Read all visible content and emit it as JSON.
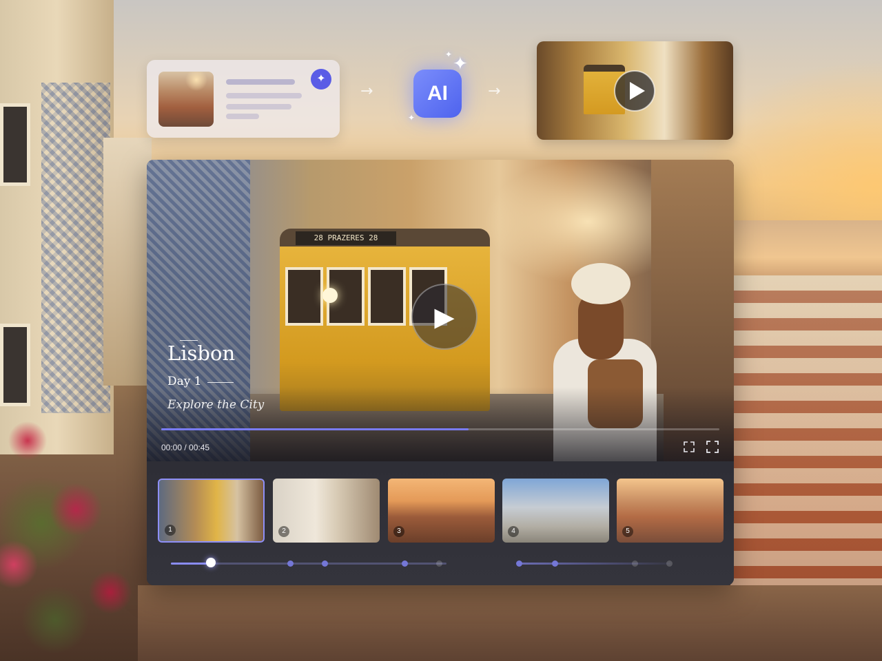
{
  "flow": {
    "ai_label": "AI",
    "arrow_1": "→",
    "arrow_2": "→",
    "sparkle_icon": "✦"
  },
  "player": {
    "caption": {
      "title": "Lisbon",
      "day": "Day 1",
      "subtitle": "Explore the City"
    },
    "tram_sign": "28  PRAZERES  28",
    "time": "00:00 / 00:45",
    "progress_fraction": 0.55,
    "icons": {
      "play": "play-icon",
      "crop": "crop-icon",
      "fullscreen": "fullscreen-icon"
    },
    "clips": [
      {
        "number": "1",
        "active": true
      },
      {
        "number": "2",
        "active": false
      },
      {
        "number": "3",
        "active": false
      },
      {
        "number": "4",
        "active": false
      },
      {
        "number": "5",
        "active": false
      }
    ]
  },
  "colors": {
    "accent": "#7a7cf4",
    "ai_badge": "#5a6cf0",
    "player_bg": "#2c2c33"
  }
}
